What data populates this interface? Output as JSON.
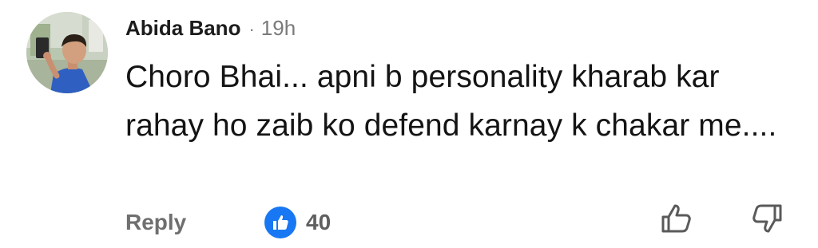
{
  "comment": {
    "author": "Abida Bano",
    "separator": "·",
    "time": "19h",
    "text": "Choro Bhai... apni b personality kharab kar rahay ho zaib ko defend karnay k chakar me....",
    "reply_label": "Reply",
    "like_count": "40",
    "avatar_icon": "avatar-photo"
  },
  "actions": {
    "like_icon": "thumbs-up-icon",
    "dislike_icon": "thumbs-down-icon"
  },
  "colors": {
    "accent": "#1877f2",
    "text_primary": "#141414",
    "text_muted": "#7a7a7a"
  }
}
